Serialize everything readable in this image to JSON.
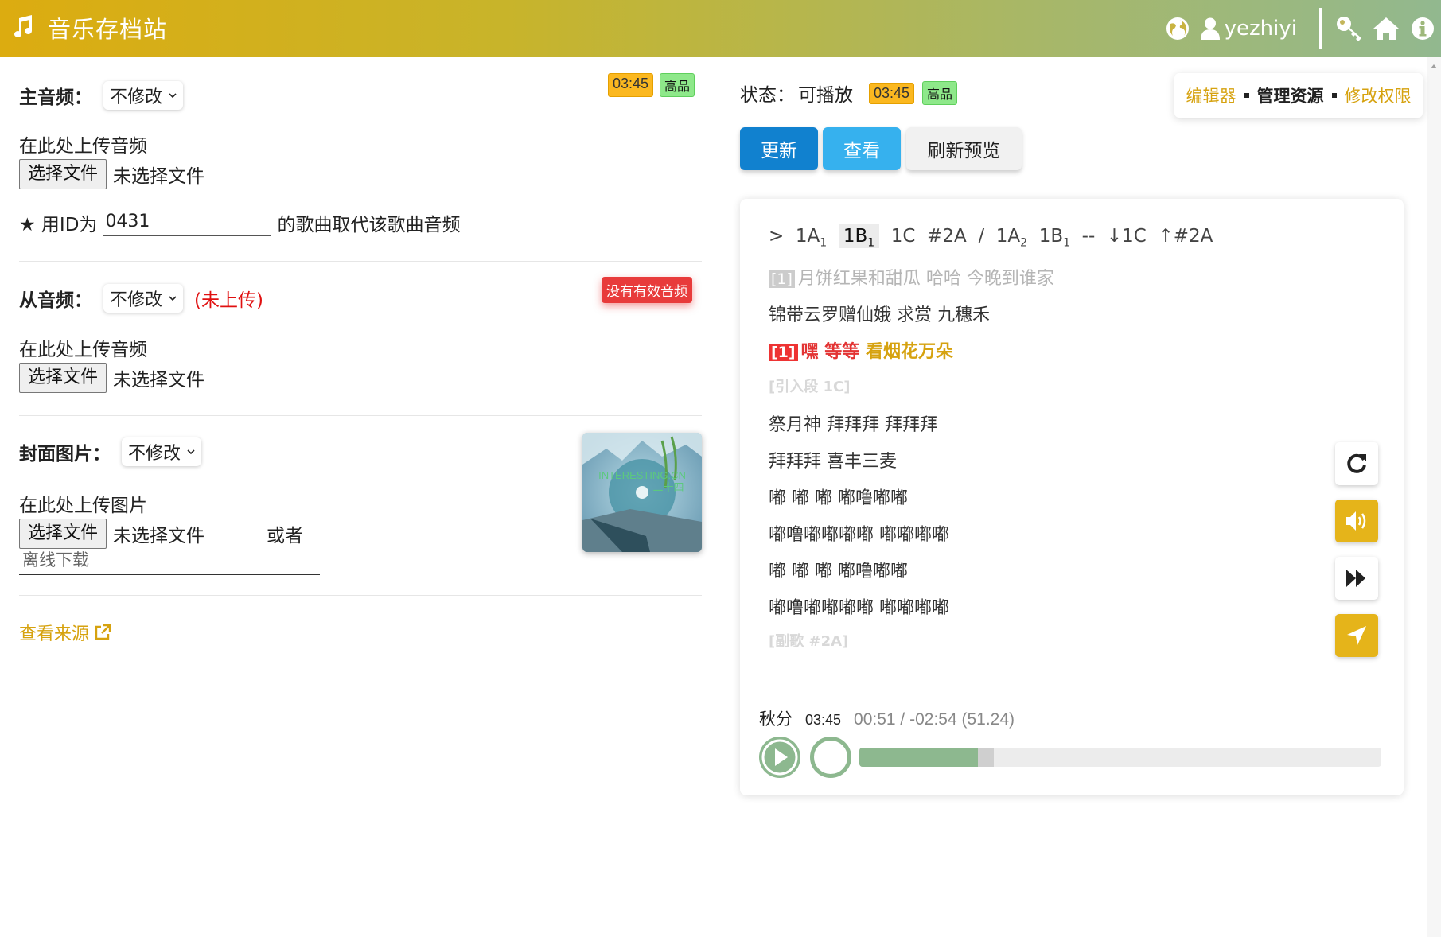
{
  "header": {
    "app_title": "音乐存档站",
    "username": "yezhiyi",
    "icons": [
      "music-note-icon",
      "globe-icon",
      "user-icon",
      "key-icon",
      "home-icon",
      "info-icon"
    ]
  },
  "main_audio": {
    "label": "主音频：",
    "select_value": "不修改",
    "duration": "03:45",
    "quality": "高品",
    "upload_hint": "在此处上传音频",
    "file_button": "选择文件",
    "file_status": "未选择文件",
    "replace_prefix": "★ 用ID为",
    "replace_id": "0431",
    "replace_suffix": "的歌曲取代该歌曲音频"
  },
  "sub_audio": {
    "label": "从音频：",
    "select_value": "不修改",
    "status": "(未上传)",
    "badge": "没有有效音频",
    "upload_hint": "在此处上传音频",
    "file_button": "选择文件",
    "file_status": "未选择文件"
  },
  "cover": {
    "label": "封面图片：",
    "select_value": "不修改",
    "upload_hint": "在此处上传图片",
    "file_button": "选择文件",
    "file_status": "未选择文件",
    "or_text": "或者",
    "offline_placeholder": "离线下载",
    "thumb_text_1": "INTERESTING.CN",
    "thumb_text_2": "二十四"
  },
  "source_link": "查看来源",
  "status": {
    "label": "状态：",
    "value": "可播放",
    "duration": "03:45",
    "quality": "高品"
  },
  "edit_links": [
    "编辑器",
    "管理资源",
    "修改权限"
  ],
  "actions": {
    "update": "更新",
    "view": "查看",
    "refresh": "刷新预览"
  },
  "lyrics": {
    "structure": {
      "arrow": ">",
      "items_a": [
        "1A",
        "1",
        "1B",
        "1",
        "1C",
        "#2A",
        "/",
        "1A",
        "2",
        "1B",
        "1",
        "--",
        "↓1C",
        "↑#2A"
      ]
    },
    "lines": [
      {
        "tag": "[1]",
        "text": "月饼红果和甜瓜 哈哈 今晚到谁家",
        "style": "faded"
      },
      {
        "text": "锦带云罗赠仙娥 求赏 九穗禾",
        "style": "normal"
      },
      {
        "tag": "[1]",
        "text_a": "嘿 等等",
        "text_b": "看烟花万朵",
        "style": "active"
      },
      {
        "text": "[引入段 1C]",
        "style": "section"
      },
      {
        "text": "祭月神 拜拜拜 拜拜拜",
        "style": "normal"
      },
      {
        "text": "拜拜拜 喜丰三麦",
        "style": "normal"
      },
      {
        "text": "嘟 嘟 嘟 嘟噜嘟嘟",
        "style": "normal"
      },
      {
        "text": "嘟噜嘟嘟嘟嘟 嘟嘟嘟嘟",
        "style": "normal"
      },
      {
        "text": "嘟 嘟 嘟 嘟噜嘟嘟",
        "style": "normal"
      },
      {
        "text": "嘟噜嘟嘟嘟嘟 嘟嘟嘟嘟",
        "style": "normal"
      },
      {
        "text": "[副歌 #2A]",
        "style": "section"
      }
    ]
  },
  "player": {
    "title": "秋分",
    "duration": "03:45",
    "position": "00:51 / -02:54 (51.24)",
    "progress": 0.227,
    "buffered": 0.258
  },
  "colors": {
    "accent": "#dcac10",
    "gold": "#e5b41a",
    "blue": "#1181cf",
    "light_blue": "#36b1ee",
    "green": "#8db88f",
    "red": "#e33333"
  }
}
